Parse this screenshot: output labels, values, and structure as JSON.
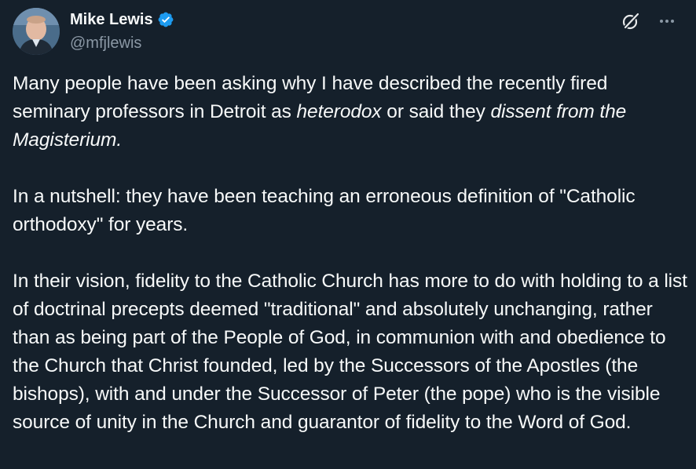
{
  "author": {
    "display_name": "Mike Lewis",
    "handle": "@mfjlewis",
    "verified": true,
    "avatar_icon": "person-avatar"
  },
  "actions": {
    "grok_icon": "grok-icon",
    "more_icon": "more-options-icon"
  },
  "colors": {
    "background": "#15202b",
    "text": "#f7f9f9",
    "secondary_text": "#8b98a5",
    "verified_badge": "#1d9bf0"
  },
  "tweet": {
    "p1": {
      "a": "Many people have been asking why I have described the recently fired seminary professors in Detroit as ",
      "b": "heterodox",
      "c": " or said they ",
      "d": "dissent from the Magisterium."
    },
    "p2": "In a nutshell: they have been teaching an erroneous definition of \"Catholic orthodoxy\" for years.",
    "p3": "In their vision, fidelity to the Catholic Church has more to do with holding to a list of doctrinal precepts deemed \"traditional\" and absolutely unchanging, rather than as being part of the People of God, in communion with and obedience to the Church that Christ founded, led by the Successors of the Apostles (the bishops), with and under the Successor of Peter (the pope) who is the visible source of unity in the Church and guarantor of fidelity to the Word of God."
  }
}
